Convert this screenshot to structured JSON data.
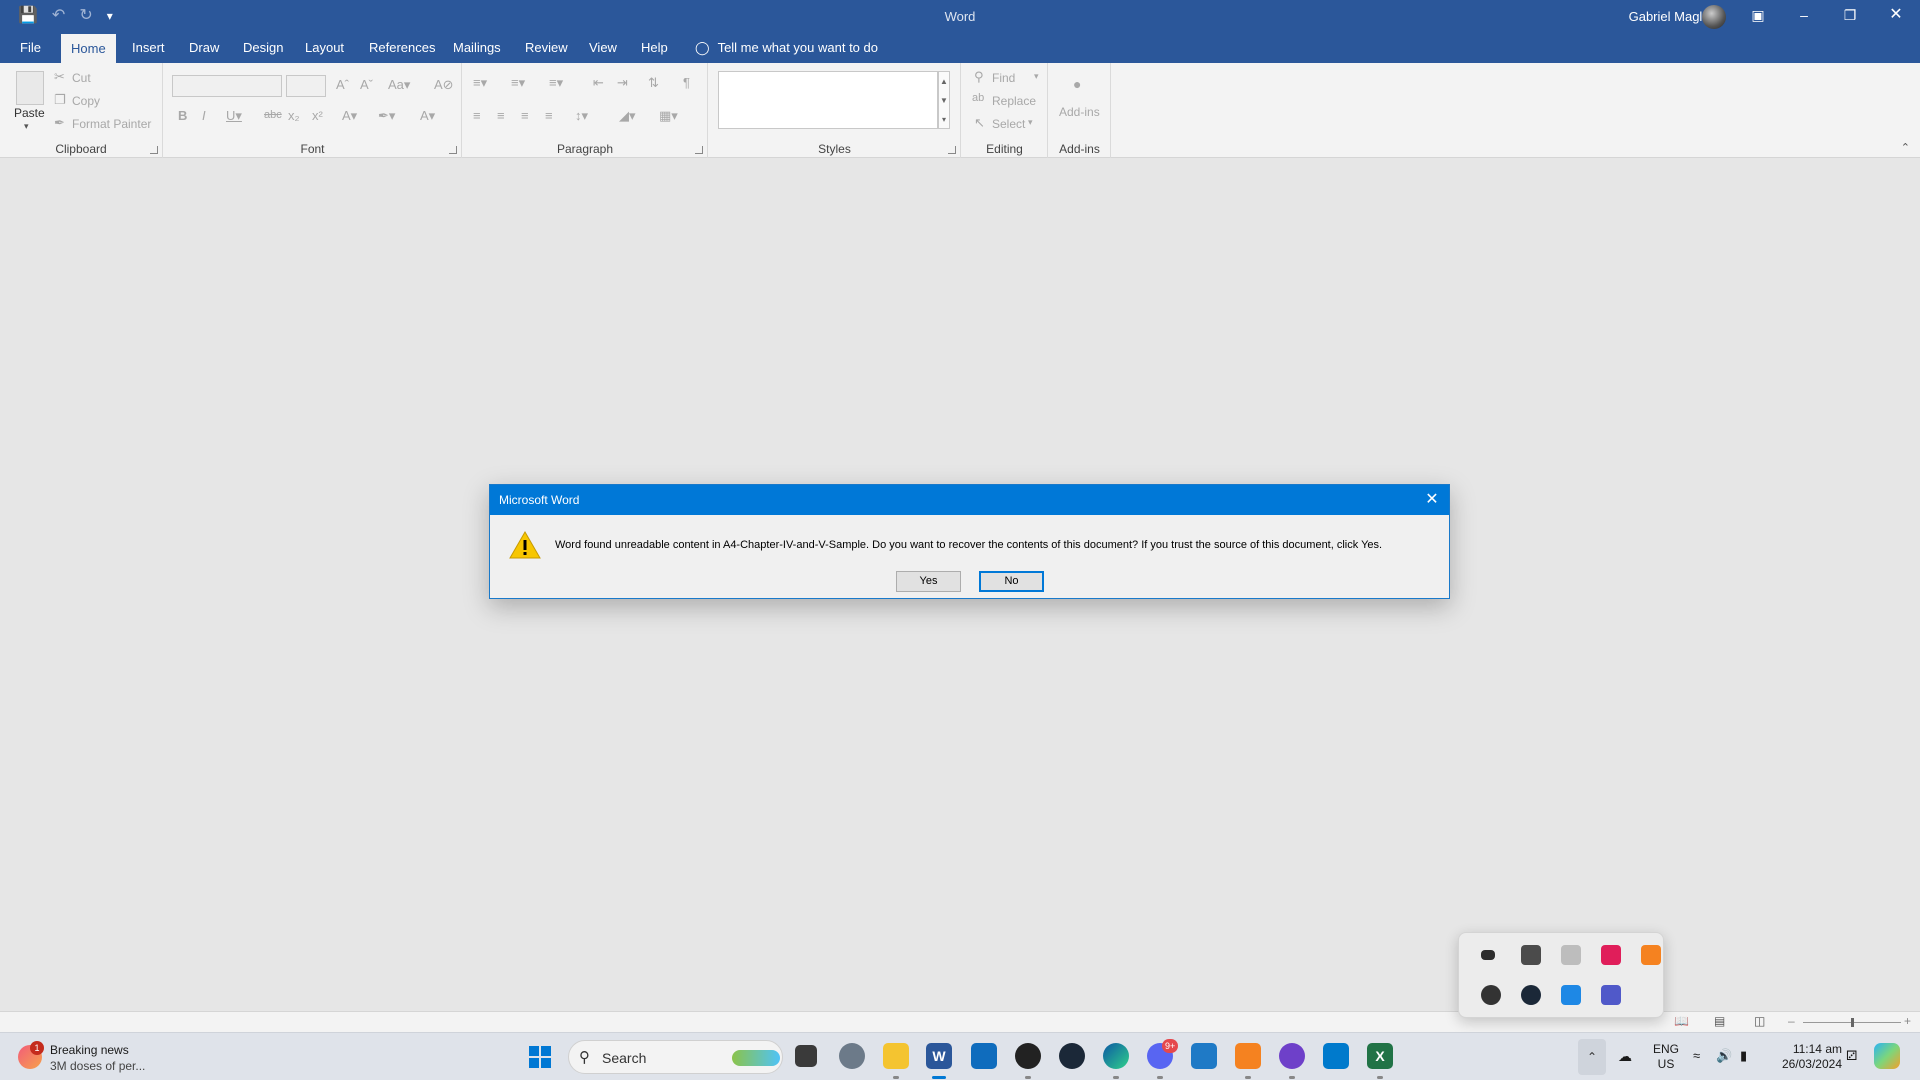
{
  "titlebar": {
    "app_title": "Word",
    "user_name": "Gabriel Maglana"
  },
  "ribbon_tabs": [
    "File",
    "Home",
    "Insert",
    "Draw",
    "Design",
    "Layout",
    "References",
    "Mailings",
    "Review",
    "View",
    "Help"
  ],
  "tell_me": "Tell me what you want to do",
  "ribbon": {
    "clipboard": {
      "paste": "Paste",
      "cut": "Cut",
      "copy": "Copy",
      "format_painter": "Format Painter",
      "label": "Clipboard"
    },
    "font": {
      "label": "Font"
    },
    "paragraph": {
      "label": "Paragraph"
    },
    "styles": {
      "label": "Styles"
    },
    "editing": {
      "find": "Find",
      "replace": "Replace",
      "select": "Select",
      "label": "Editing"
    },
    "addins": {
      "button": "Add-ins",
      "label": "Add-ins"
    }
  },
  "dialog": {
    "title": "Microsoft Word",
    "message": "Word found unreadable content in A4-Chapter-IV-and-V-Sample. Do you want to recover the contents of this document? If you trust the source of this document, click Yes.",
    "yes_label": "Yes",
    "no_label": "No"
  },
  "taskbar": {
    "news_badge": "1",
    "news_title": "Breaking news",
    "news_subtitle": "3M doses of per...",
    "search_placeholder": "Search",
    "discord_badge": "9+",
    "language": "ENG",
    "region": "US",
    "time": "11:14 am",
    "date": "26/03/2024"
  },
  "colors": {
    "word_blue": "#2b579a",
    "dialog_title_blue": "#0078d7",
    "warning_yellow": "#f7c600"
  }
}
